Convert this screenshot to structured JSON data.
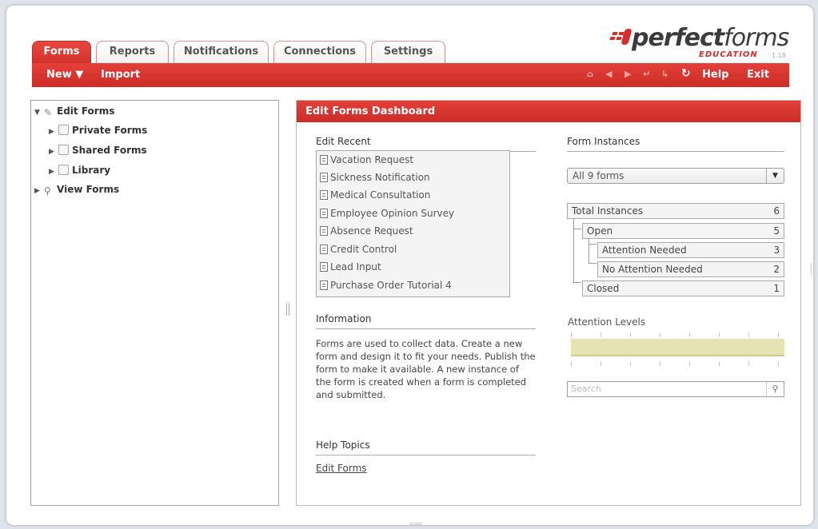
{
  "header": {
    "tabs": [
      {
        "label": "Forms",
        "active": true
      },
      {
        "label": "Reports",
        "active": false
      },
      {
        "label": "Notifications",
        "active": false
      },
      {
        "label": "Connections",
        "active": false
      },
      {
        "label": "Settings",
        "active": false
      }
    ],
    "logo": {
      "brand_bold": "perfect",
      "brand_light": "forms",
      "edition": "EDUCATION",
      "version": "1.18"
    },
    "toolbar": {
      "new_label": "New ▼",
      "import_label": "Import",
      "help_label": "Help",
      "exit_label": "Exit",
      "nav_icons": [
        "home-icon",
        "back-icon",
        "forward-icon",
        "undo-icon",
        "redo-icon",
        "refresh-icon"
      ]
    }
  },
  "tree": {
    "items": [
      {
        "label": "Edit Forms",
        "icon": "pencil-icon",
        "expanded": true
      },
      {
        "label": "Private Forms",
        "icon": "private-folder-icon"
      },
      {
        "label": "Shared Forms",
        "icon": "shared-folder-icon"
      },
      {
        "label": "Library",
        "icon": "library-icon"
      },
      {
        "label": "View Forms",
        "icon": "magnifier-icon"
      }
    ]
  },
  "dashboard": {
    "title": "Edit Forms Dashboard",
    "recent": {
      "title": "Edit Recent",
      "items": [
        "Vacation Request",
        "Sickness Notification",
        "Medical Consultation",
        "Employee Opinion Survey",
        "Absence Request",
        "Credit Control",
        "Lead Input",
        "Purchase Order Tutorial 4"
      ]
    },
    "information": {
      "title": "Information",
      "text": "Forms are used to collect data. Create a new form and design it to fit your needs. Publish the form to make it available. A new instance of the form is created when a form is completed and submitted."
    },
    "help": {
      "title": "Help Topics",
      "link": "Edit Forms"
    },
    "instances": {
      "title": "Form Instances",
      "filter": "All 9 forms",
      "total": {
        "label": "Total Instances",
        "count": "6"
      },
      "open": {
        "label": "Open",
        "count": "5"
      },
      "attention": {
        "label": "Attention Needed",
        "count": "3"
      },
      "no_attention": {
        "label": "No Attention Needed",
        "count": "2"
      },
      "closed": {
        "label": "Closed",
        "count": "1"
      }
    },
    "attention_levels": {
      "title": "Attention Levels"
    },
    "search": {
      "placeholder": "Search"
    }
  },
  "colors": {
    "accent": "#d2302b",
    "bar": "#e6e3b3"
  }
}
